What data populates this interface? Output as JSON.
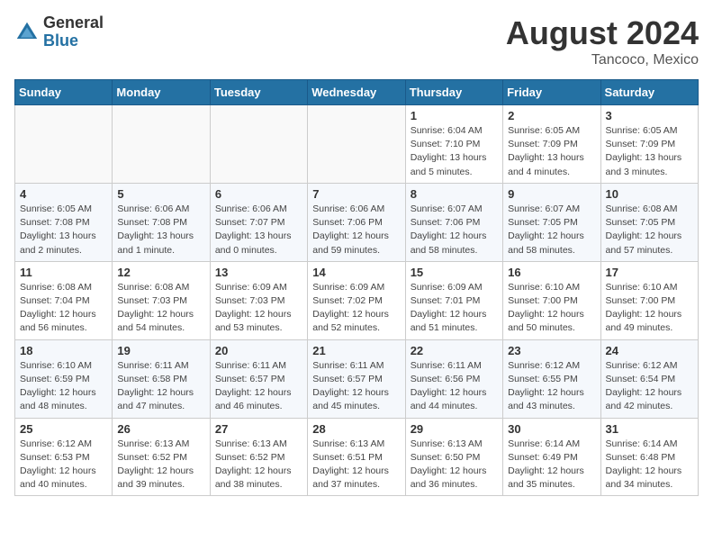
{
  "header": {
    "logo_general": "General",
    "logo_blue": "Blue",
    "month_year": "August 2024",
    "location": "Tancoco, Mexico"
  },
  "days_of_week": [
    "Sunday",
    "Monday",
    "Tuesday",
    "Wednesday",
    "Thursday",
    "Friday",
    "Saturday"
  ],
  "weeks": [
    [
      {
        "day": "",
        "info": ""
      },
      {
        "day": "",
        "info": ""
      },
      {
        "day": "",
        "info": ""
      },
      {
        "day": "",
        "info": ""
      },
      {
        "day": "1",
        "info": "Sunrise: 6:04 AM\nSunset: 7:10 PM\nDaylight: 13 hours\nand 5 minutes."
      },
      {
        "day": "2",
        "info": "Sunrise: 6:05 AM\nSunset: 7:09 PM\nDaylight: 13 hours\nand 4 minutes."
      },
      {
        "day": "3",
        "info": "Sunrise: 6:05 AM\nSunset: 7:09 PM\nDaylight: 13 hours\nand 3 minutes."
      }
    ],
    [
      {
        "day": "4",
        "info": "Sunrise: 6:05 AM\nSunset: 7:08 PM\nDaylight: 13 hours\nand 2 minutes."
      },
      {
        "day": "5",
        "info": "Sunrise: 6:06 AM\nSunset: 7:08 PM\nDaylight: 13 hours\nand 1 minute."
      },
      {
        "day": "6",
        "info": "Sunrise: 6:06 AM\nSunset: 7:07 PM\nDaylight: 13 hours\nand 0 minutes."
      },
      {
        "day": "7",
        "info": "Sunrise: 6:06 AM\nSunset: 7:06 PM\nDaylight: 12 hours\nand 59 minutes."
      },
      {
        "day": "8",
        "info": "Sunrise: 6:07 AM\nSunset: 7:06 PM\nDaylight: 12 hours\nand 58 minutes."
      },
      {
        "day": "9",
        "info": "Sunrise: 6:07 AM\nSunset: 7:05 PM\nDaylight: 12 hours\nand 58 minutes."
      },
      {
        "day": "10",
        "info": "Sunrise: 6:08 AM\nSunset: 7:05 PM\nDaylight: 12 hours\nand 57 minutes."
      }
    ],
    [
      {
        "day": "11",
        "info": "Sunrise: 6:08 AM\nSunset: 7:04 PM\nDaylight: 12 hours\nand 56 minutes."
      },
      {
        "day": "12",
        "info": "Sunrise: 6:08 AM\nSunset: 7:03 PM\nDaylight: 12 hours\nand 54 minutes."
      },
      {
        "day": "13",
        "info": "Sunrise: 6:09 AM\nSunset: 7:03 PM\nDaylight: 12 hours\nand 53 minutes."
      },
      {
        "day": "14",
        "info": "Sunrise: 6:09 AM\nSunset: 7:02 PM\nDaylight: 12 hours\nand 52 minutes."
      },
      {
        "day": "15",
        "info": "Sunrise: 6:09 AM\nSunset: 7:01 PM\nDaylight: 12 hours\nand 51 minutes."
      },
      {
        "day": "16",
        "info": "Sunrise: 6:10 AM\nSunset: 7:00 PM\nDaylight: 12 hours\nand 50 minutes."
      },
      {
        "day": "17",
        "info": "Sunrise: 6:10 AM\nSunset: 7:00 PM\nDaylight: 12 hours\nand 49 minutes."
      }
    ],
    [
      {
        "day": "18",
        "info": "Sunrise: 6:10 AM\nSunset: 6:59 PM\nDaylight: 12 hours\nand 48 minutes."
      },
      {
        "day": "19",
        "info": "Sunrise: 6:11 AM\nSunset: 6:58 PM\nDaylight: 12 hours\nand 47 minutes."
      },
      {
        "day": "20",
        "info": "Sunrise: 6:11 AM\nSunset: 6:57 PM\nDaylight: 12 hours\nand 46 minutes."
      },
      {
        "day": "21",
        "info": "Sunrise: 6:11 AM\nSunset: 6:57 PM\nDaylight: 12 hours\nand 45 minutes."
      },
      {
        "day": "22",
        "info": "Sunrise: 6:11 AM\nSunset: 6:56 PM\nDaylight: 12 hours\nand 44 minutes."
      },
      {
        "day": "23",
        "info": "Sunrise: 6:12 AM\nSunset: 6:55 PM\nDaylight: 12 hours\nand 43 minutes."
      },
      {
        "day": "24",
        "info": "Sunrise: 6:12 AM\nSunset: 6:54 PM\nDaylight: 12 hours\nand 42 minutes."
      }
    ],
    [
      {
        "day": "25",
        "info": "Sunrise: 6:12 AM\nSunset: 6:53 PM\nDaylight: 12 hours\nand 40 minutes."
      },
      {
        "day": "26",
        "info": "Sunrise: 6:13 AM\nSunset: 6:52 PM\nDaylight: 12 hours\nand 39 minutes."
      },
      {
        "day": "27",
        "info": "Sunrise: 6:13 AM\nSunset: 6:52 PM\nDaylight: 12 hours\nand 38 minutes."
      },
      {
        "day": "28",
        "info": "Sunrise: 6:13 AM\nSunset: 6:51 PM\nDaylight: 12 hours\nand 37 minutes."
      },
      {
        "day": "29",
        "info": "Sunrise: 6:13 AM\nSunset: 6:50 PM\nDaylight: 12 hours\nand 36 minutes."
      },
      {
        "day": "30",
        "info": "Sunrise: 6:14 AM\nSunset: 6:49 PM\nDaylight: 12 hours\nand 35 minutes."
      },
      {
        "day": "31",
        "info": "Sunrise: 6:14 AM\nSunset: 6:48 PM\nDaylight: 12 hours\nand 34 minutes."
      }
    ]
  ]
}
